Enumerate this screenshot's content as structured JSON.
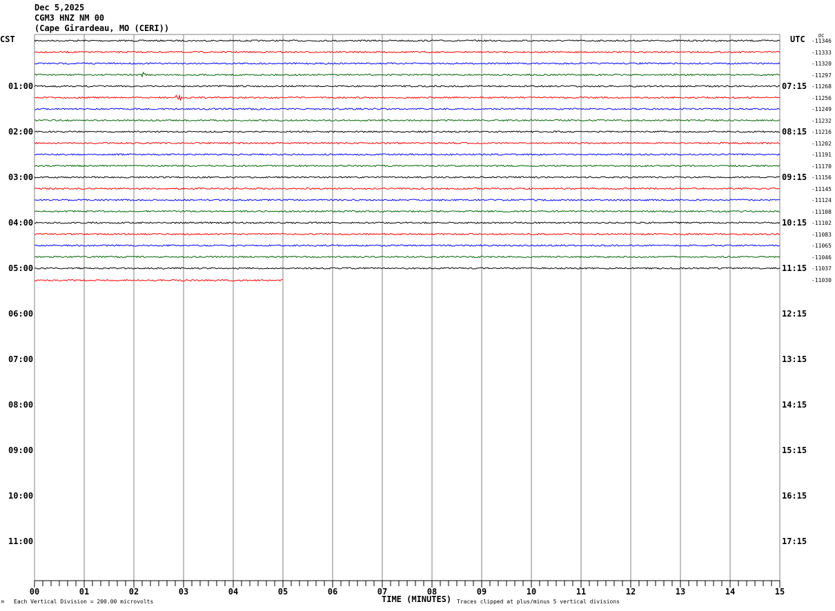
{
  "header": {
    "date": "Dec 5,2025",
    "station": "CGM3 HNZ NM 00",
    "location": "(Cape Girardeau, MO (CERI))"
  },
  "left_axis_title": "CST",
  "right_axis_title": "UTC",
  "dc_title": "DC",
  "left_hour_labels": [
    "01:00",
    "02:00",
    "03:00",
    "04:00",
    "05:00",
    "06:00",
    "07:00",
    "08:00",
    "09:00",
    "10:00",
    "11:00"
  ],
  "right_hour_labels": [
    "07:15",
    "08:15",
    "09:15",
    "10:15",
    "11:15",
    "12:15",
    "13:15",
    "14:15",
    "15:15",
    "16:15",
    "17:15"
  ],
  "dc_values": [
    "-11346",
    "-11333",
    "-11320",
    "-11297",
    "-11268",
    "-11256",
    "-11249",
    "-11232",
    "-11216",
    "-11202",
    "-11191",
    "-11170",
    "-11156",
    "-11145",
    "-11124",
    "-11108",
    "-11102",
    "-11083",
    "-11065",
    "-11046",
    "-11037",
    "-11030"
  ],
  "footer": {
    "xlabel": "TIME (MINUTES)",
    "scale_note": "Each Vertical Division =  200.00 microvolts",
    "clip_note": "Traces clipped at plus/minus 5 vertical divisions",
    "corner_mark": "M"
  },
  "chart_data": {
    "type": "line",
    "title": "Dec 5,2025 CGM3 HNZ NM 00",
    "xlabel": "TIME (MINUTES)",
    "x_tick_labels": [
      "00",
      "01",
      "02",
      "03",
      "04",
      "05",
      "06",
      "07",
      "08",
      "09",
      "10",
      "11",
      "12",
      "13",
      "14",
      "15"
    ],
    "xlim": [
      0,
      15
    ],
    "rows_per_hour": 4,
    "total_rows": 48,
    "trace_colors": [
      "#000000",
      "#ff0000",
      "#0000ff",
      "#006400"
    ],
    "grid_color": "#808080",
    "full_rows": 21,
    "last_row_end_minute": 5,
    "events": [
      {
        "row": 3,
        "minute": 2.2
      },
      {
        "row": 5,
        "minute": 2.9
      }
    ]
  }
}
